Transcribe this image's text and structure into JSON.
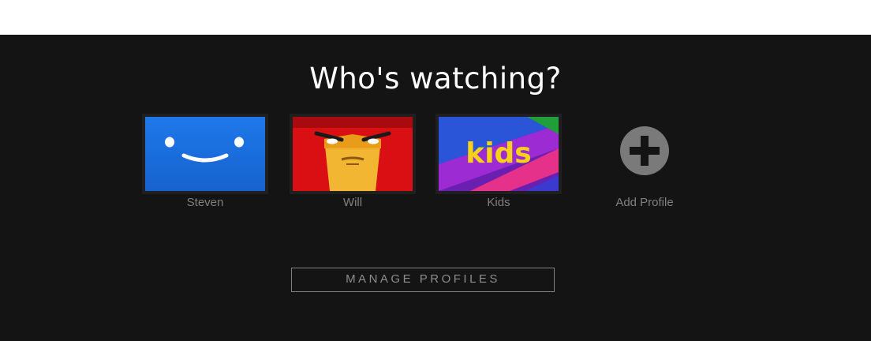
{
  "page": {
    "title": "Who's watching?"
  },
  "profiles": [
    {
      "name": "Steven",
      "avatar_icon": "smiley-face-icon",
      "color": "#1a6fe0"
    },
    {
      "name": "Will",
      "avatar_icon": "angry-face-icon",
      "color": "#d40d12"
    },
    {
      "name": "Kids",
      "avatar_icon": "kids-logo-icon",
      "logo_text": "kids",
      "color": "#7b1fa2"
    }
  ],
  "add_profile": {
    "label": "Add Profile",
    "icon": "plus-circle-icon"
  },
  "manage_button": {
    "label": "MANAGE PROFILES"
  },
  "colors": {
    "background": "#141414",
    "text_muted": "#808080",
    "kids_yellow": "#f7d117"
  }
}
